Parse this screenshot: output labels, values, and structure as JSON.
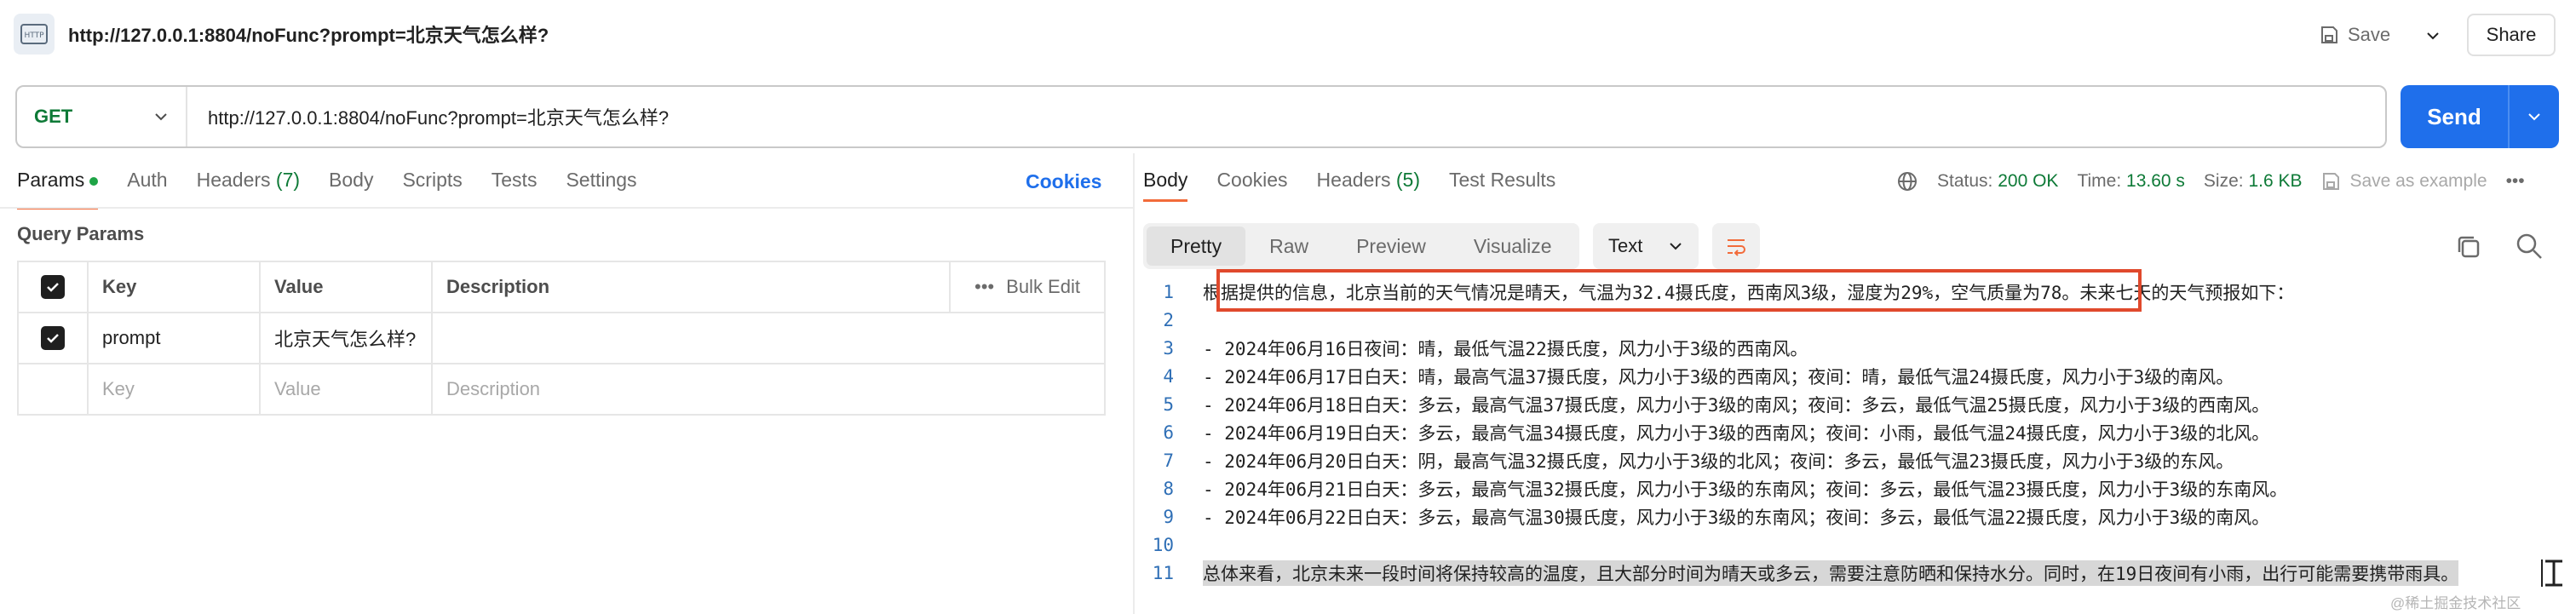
{
  "header": {
    "icon_text": "HTTP",
    "title": "http://127.0.0.1:8804/noFunc?prompt=北京天气怎么样?",
    "save_label": "Save",
    "share_label": "Share"
  },
  "request": {
    "method": "GET",
    "url": "http://127.0.0.1:8804/noFunc?prompt=北京天气怎么样?",
    "send_label": "Send"
  },
  "request_tabs": {
    "items": [
      "Params",
      "Auth",
      "Headers",
      "(7)",
      "Body",
      "Scripts",
      "Tests",
      "Settings"
    ],
    "cookies": "Cookies",
    "section_label": "Query Params"
  },
  "params_table": {
    "headers": [
      "Key",
      "Value",
      "Description"
    ],
    "bulk_edit": "Bulk Edit",
    "more": "•••",
    "rows": [
      {
        "key": "prompt",
        "value": "北京天气怎么样?",
        "description": ""
      }
    ],
    "placeholders": {
      "key": "Key",
      "value": "Value",
      "description": "Description"
    }
  },
  "response_tabs": {
    "body": "Body",
    "cookies": "Cookies",
    "headers": "Headers",
    "headers_count": "(5)",
    "test_results": "Test Results"
  },
  "response_status": {
    "status_label": "Status:",
    "status_value": "200 OK",
    "time_label": "Time:",
    "time_value": "13.60 s",
    "size_label": "Size:",
    "size_value": "1.6 KB",
    "save_example": "Save as example",
    "more": "•••"
  },
  "response_view": {
    "modes": [
      "Pretty",
      "Raw",
      "Preview",
      "Visualize"
    ],
    "format": "Text"
  },
  "code_lines": [
    {
      "n": "1",
      "text": "根据提供的信息，北京当前的天气情况是晴天，气温为32.4摄氏度，西南风3级，湿度为29%，空气质量为78。未来七天的天气预报如下："
    },
    {
      "n": "2",
      "text": ""
    },
    {
      "n": "3",
      "text": "- 2024年06月16日夜间：晴，最低气温22摄氏度，风力小于3级的西南风。"
    },
    {
      "n": "4",
      "text": "- 2024年06月17日白天：晴，最高气温37摄氏度，风力小于3级的西南风；夜间：晴，最低气温24摄氏度，风力小于3级的南风。"
    },
    {
      "n": "5",
      "text": "- 2024年06月18日白天：多云，最高气温37摄氏度，风力小于3级的南风；夜间：多云，最低气温25摄氏度，风力小于3级的西南风。"
    },
    {
      "n": "6",
      "text": "- 2024年06月19日白天：多云，最高气温34摄氏度，风力小于3级的西南风；夜间：小雨，最低气温24摄氏度，风力小于3级的北风。"
    },
    {
      "n": "7",
      "text": "- 2024年06月20日白天：阴，最高气温32摄氏度，风力小于3级的北风；夜间：多云，最低气温23摄氏度，风力小于3级的东风。"
    },
    {
      "n": "8",
      "text": "- 2024年06月21日白天：多云，最高气温32摄氏度，风力小于3级的东南风；夜间：多云，最低气温23摄氏度，风力小于3级的东南风。"
    },
    {
      "n": "9",
      "text": "- 2024年06月22日白天：多云，最高气温30摄氏度，风力小于3级的东南风；夜间：多云，最低气温22摄氏度，风力小于3级的南风。"
    },
    {
      "n": "10",
      "text": ""
    },
    {
      "n": "11",
      "text": "总体来看，北京未来一段时间将保持较高的温度，且大部分时间为晴天或多云，需要注意防晒和保持水分。同时，在19日夜间有小雨，出行可能需要携带雨具。"
    }
  ],
  "watermark": "@稀土掘金技术社区",
  "colors": {
    "accent": "#1f6feb",
    "tab_indicator": "#f26b3a",
    "method": "#0e7a37",
    "highlight_box": "#e0492c"
  }
}
